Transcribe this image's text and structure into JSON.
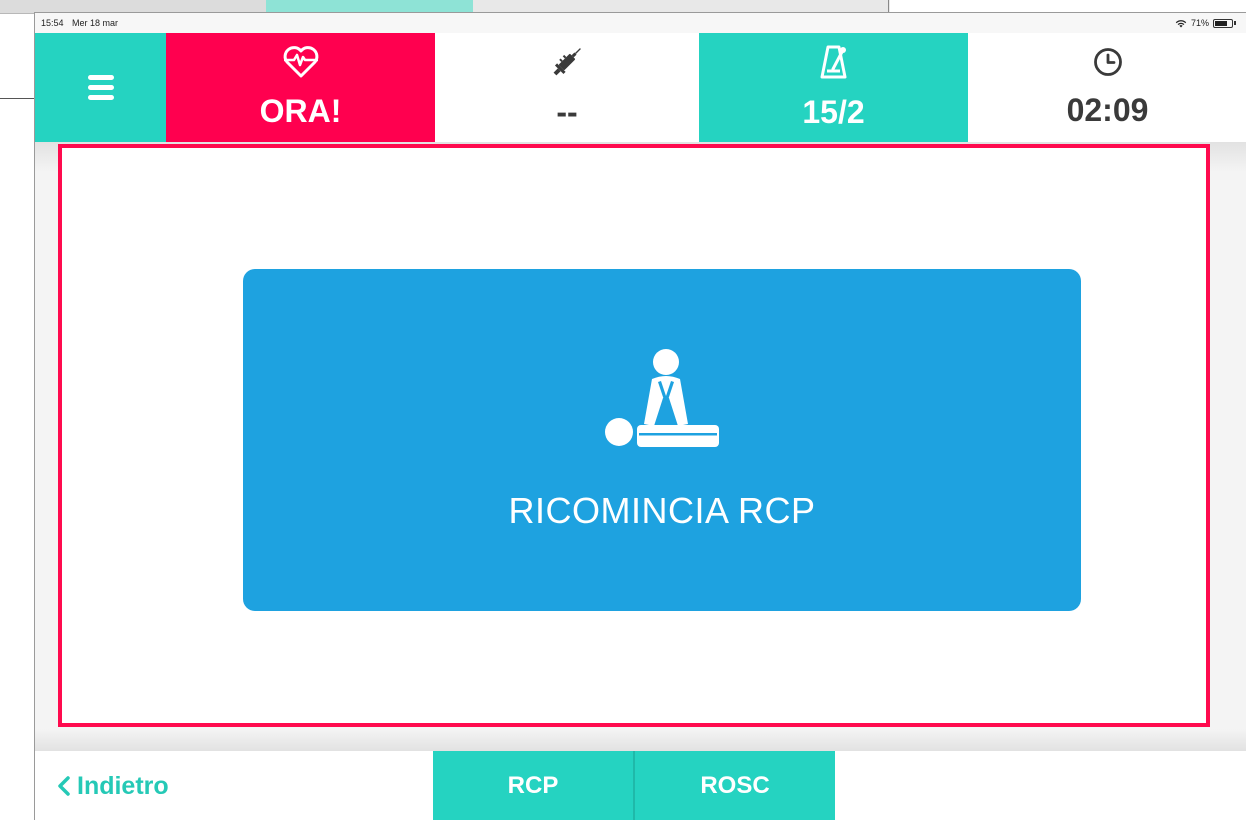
{
  "status_bar": {
    "time": "15:54",
    "date": "Mer 18 mar",
    "battery": "71%"
  },
  "topbar": {
    "ora": {
      "label": "ORA!",
      "icon": "heart-monitor-icon"
    },
    "drug": {
      "label": "--",
      "icon": "syringe-icon"
    },
    "cycle": {
      "label": "15/2",
      "icon": "metronome-icon"
    },
    "timer": {
      "label": "02:09",
      "icon": "clock-icon"
    }
  },
  "main": {
    "cta_label": "RICOMINCIA RCP",
    "cta_icon": "cpr-icon"
  },
  "bottombar": {
    "back_label": "Indietro",
    "tab_rcp": "RCP",
    "tab_rosc": "ROSC"
  },
  "colors": {
    "teal": "#25d3c1",
    "alert_red": "#ff004f",
    "button_blue": "#1ea2e0",
    "panel_border": "#ff0a4e"
  }
}
